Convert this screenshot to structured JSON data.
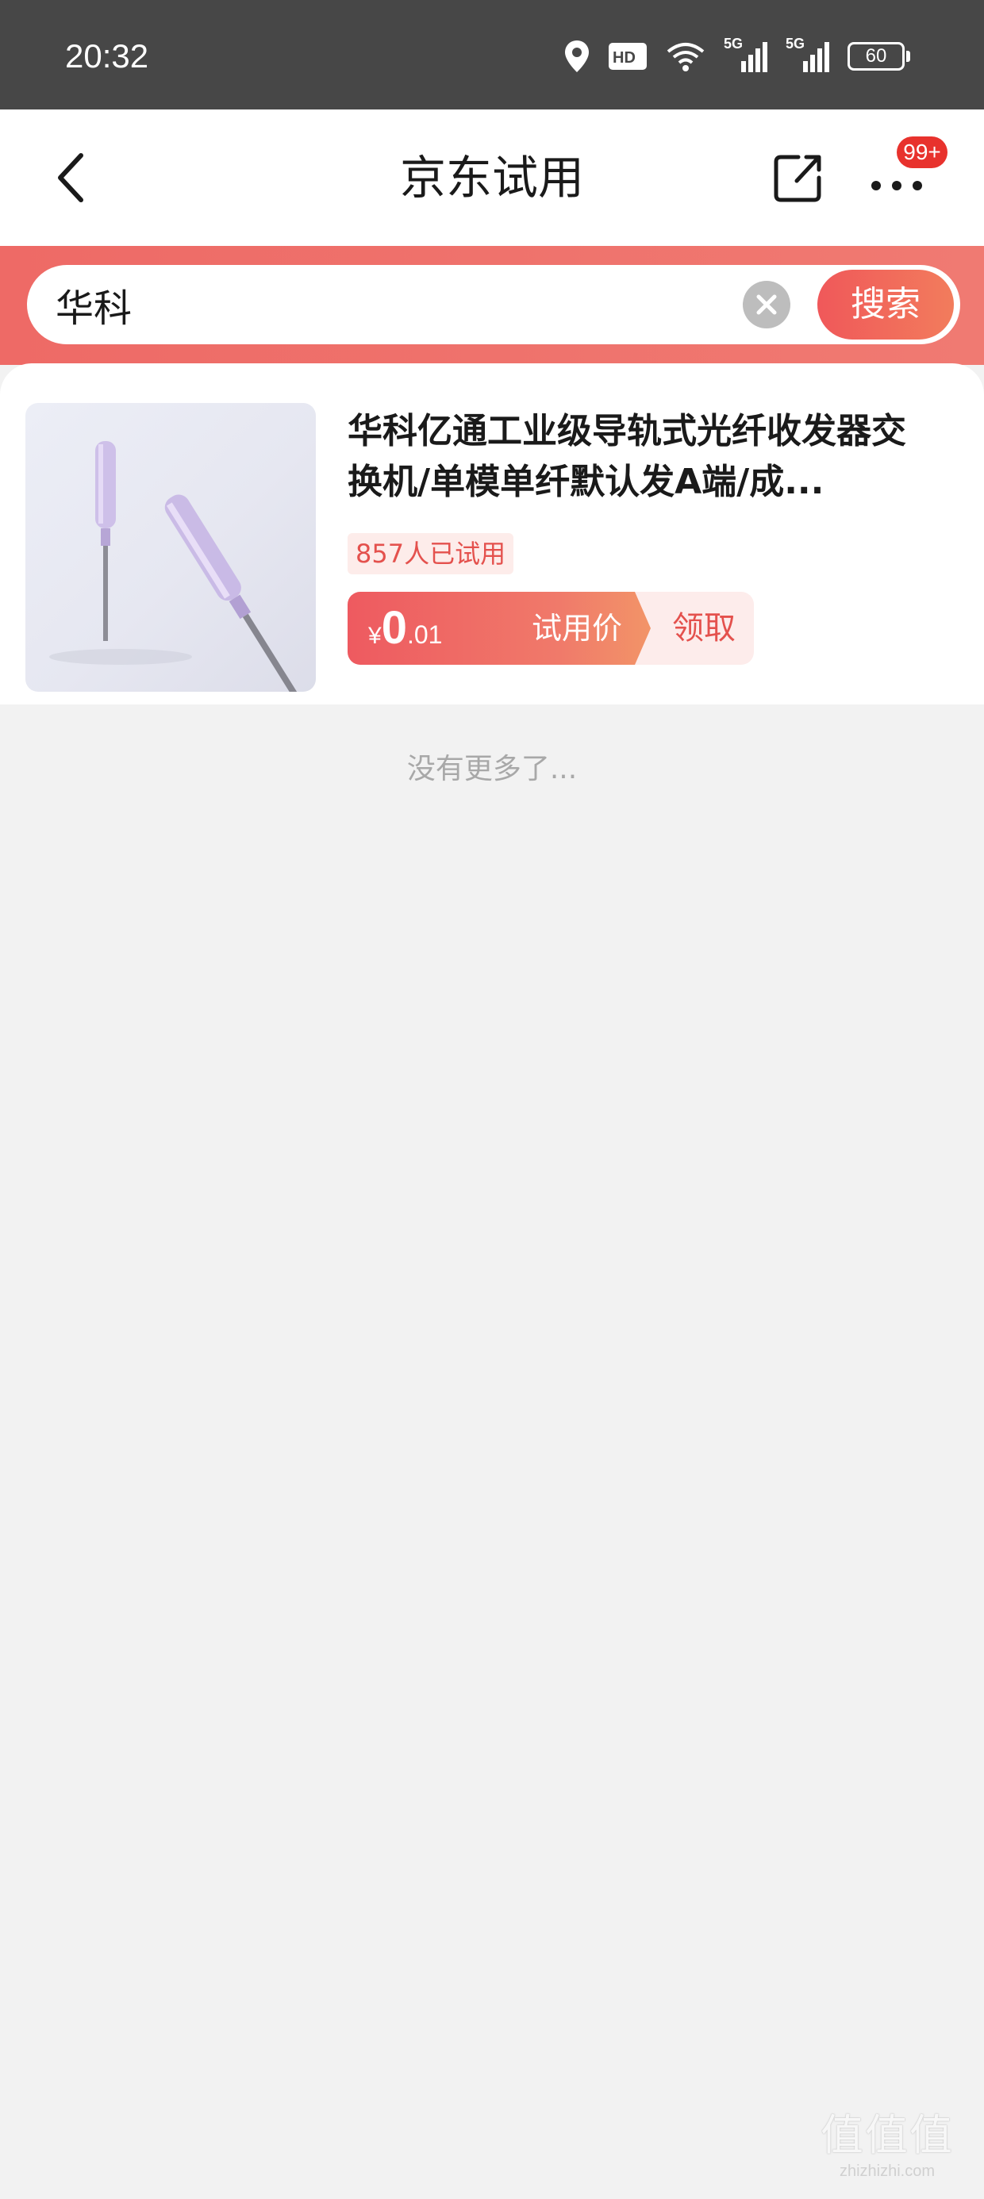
{
  "status_bar": {
    "time": "20:32",
    "network_1": "5G",
    "network_2": "5G",
    "battery": "60",
    "hd_label": "HD"
  },
  "header": {
    "title": "京东试用",
    "badge": "99+"
  },
  "search": {
    "value": "华科",
    "button_label": "搜索"
  },
  "results": [
    {
      "title": "华科亿通工业级导轨式光纤收发器交换机/单模单纤默认发A端/成...",
      "trial_count": "857人已试用",
      "price_symbol": "¥",
      "price_int": "0",
      "price_dec": ".01",
      "price_label": "试用价",
      "claim_label": "领取"
    }
  ],
  "footer": {
    "no_more": "没有更多了..."
  },
  "watermark": {
    "logo_text": "值值值",
    "url": "zhizhizhi.com"
  },
  "colors": {
    "status_bar_bg": "#474747",
    "accent_red": "#ee5a60",
    "search_band": "#ee6a66",
    "badge_red": "#e8322d"
  },
  "icons": [
    "back-arrow-icon",
    "share-icon",
    "more-dots-icon",
    "location-icon",
    "wifi-icon",
    "signal-icon",
    "battery-icon",
    "clear-icon"
  ]
}
